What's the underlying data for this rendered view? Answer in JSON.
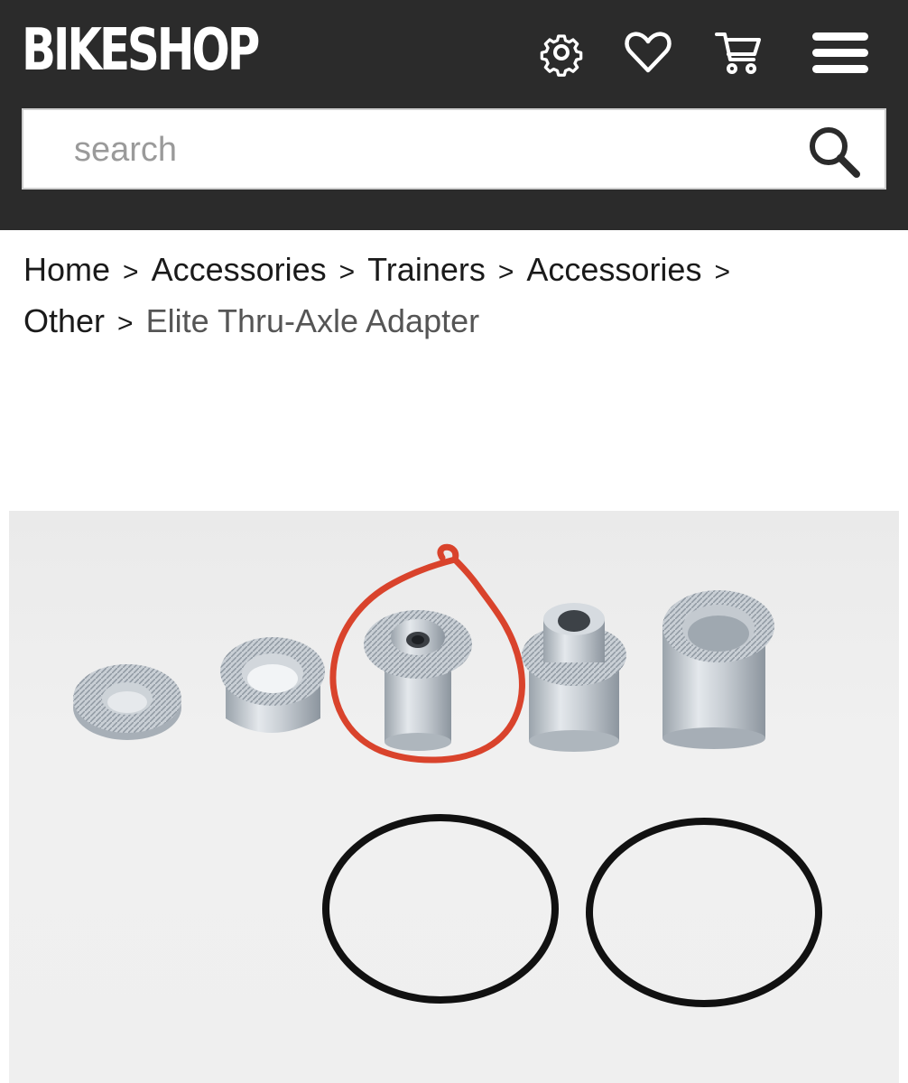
{
  "header": {
    "logo": "BIKESHOP",
    "icons": [
      "gear-icon",
      "heart-icon",
      "cart-icon",
      "menu-icon"
    ],
    "background": "#2b2b2b"
  },
  "search": {
    "placeholder": "search",
    "icon": "search-icon"
  },
  "breadcrumb": {
    "items": [
      "Home",
      "Accessories",
      "Trainers",
      "Accessories",
      "Other"
    ],
    "separator": ">",
    "current": "Elite Thru-Axle Adapter"
  },
  "product_image": {
    "alt": "Elite Thru-Axle Adapter parts",
    "annotation_color": "#d9432c"
  }
}
